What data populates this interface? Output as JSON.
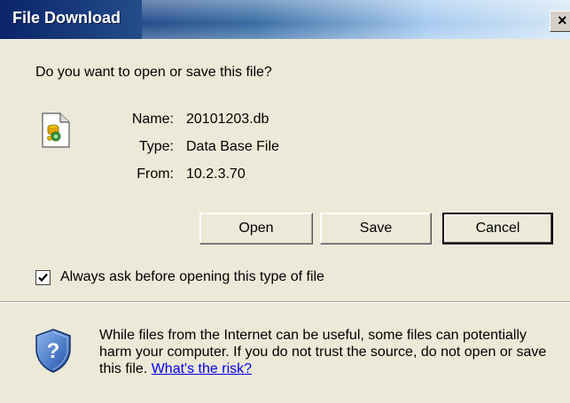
{
  "window": {
    "title": "File Download",
    "close_glyph": "×",
    "title_color": "#0a246a"
  },
  "prompt": {
    "question": "Do you want to open or save this file?"
  },
  "file": {
    "icon": "database-file-icon",
    "name_label": "Name:",
    "name": "20101203.db",
    "type_label": "Type:",
    "type": "Data Base File",
    "from_label": "From:",
    "from": "10.2.3.70"
  },
  "buttons": {
    "open": "Open",
    "save": "Save",
    "cancel": "Cancel"
  },
  "always_ask": {
    "label": "Always ask before opening this type of file",
    "checked": true
  },
  "warning": {
    "icon": "shield-question-icon",
    "text": "While files from the Internet can be useful, some files can potentially harm your computer. If you do not trust the source, do not open or save this file.",
    "link": "What's the risk?",
    "link_color": "#0000ee"
  }
}
